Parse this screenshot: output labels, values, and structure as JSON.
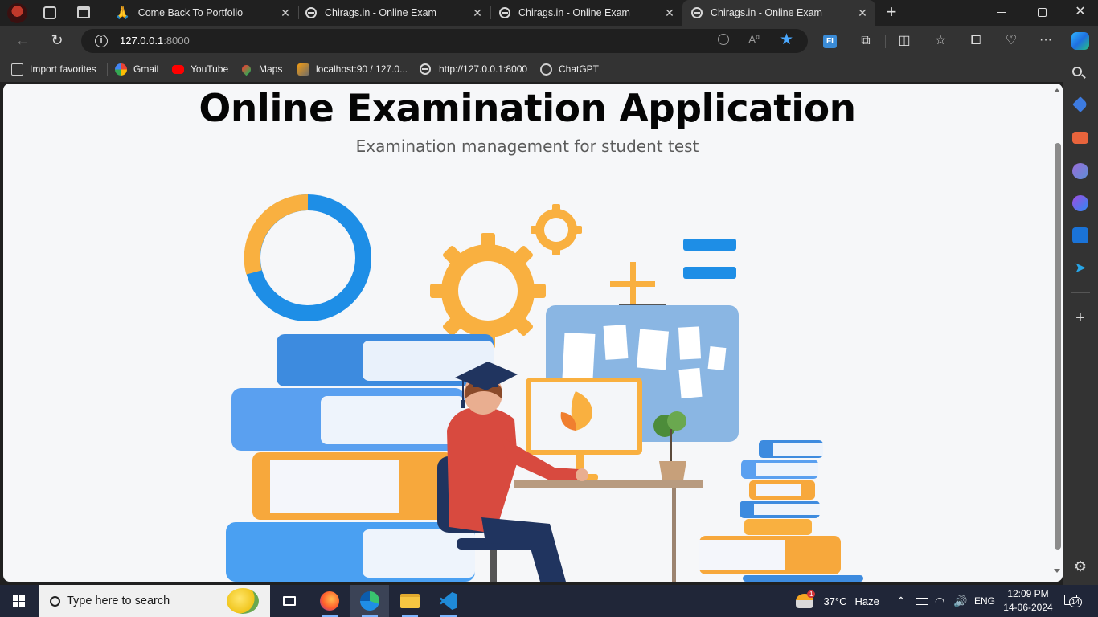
{
  "browser": {
    "tabs": [
      {
        "title": "Come Back To Portfolio",
        "active": false,
        "icon": "praying-hands-icon"
      },
      {
        "title": "Chirags.in - Online Exam",
        "active": false,
        "icon": "globe-icon"
      },
      {
        "title": "Chirags.in - Online Exam",
        "active": false,
        "icon": "globe-icon"
      },
      {
        "title": "Chirags.in - Online Exam",
        "active": true,
        "icon": "globe-icon"
      }
    ],
    "address": {
      "host": "127.0.0.1",
      "port": ":8000"
    },
    "favorites": [
      {
        "label": "Import favorites",
        "icon": "import-icon"
      },
      {
        "label": "Gmail",
        "icon": "google-icon"
      },
      {
        "label": "YouTube",
        "icon": "youtube-icon"
      },
      {
        "label": "Maps",
        "icon": "maps-pin-icon"
      },
      {
        "label": "localhost:90 / 127.0...",
        "icon": "phpmyadmin-icon"
      },
      {
        "label": "http://127.0.0.1:8000",
        "icon": "globe-icon"
      },
      {
        "label": "ChatGPT",
        "icon": "chatgpt-icon"
      }
    ]
  },
  "page": {
    "title": "Online Examination Application",
    "subtitle": "Examination management for student test"
  },
  "taskbar": {
    "search_placeholder": "Type here to search",
    "weather": {
      "temp": "37°C",
      "condition": "Haze",
      "badge": "1"
    },
    "language": "ENG",
    "time": "12:09 PM",
    "date": "14-06-2024",
    "notifications": "14"
  },
  "colors": {
    "accent_blue": "#1e8ee6",
    "accent_orange": "#f9b040",
    "student_red": "#d84a3f",
    "navy": "#20345f"
  }
}
